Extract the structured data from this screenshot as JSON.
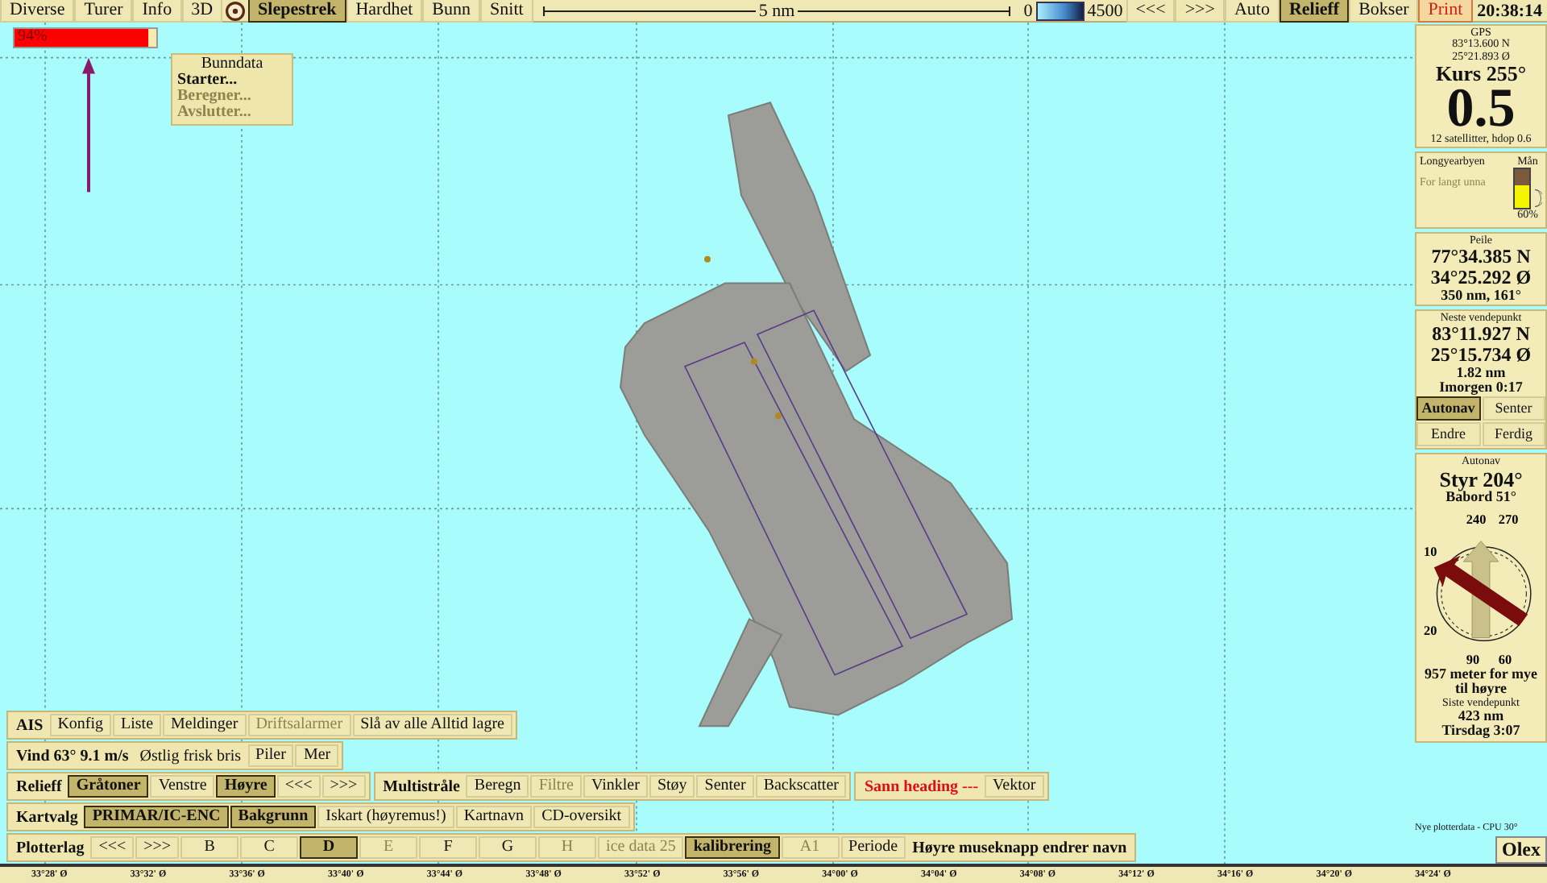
{
  "top_bar": {
    "items": [
      {
        "label": "Diverse",
        "kind": "button",
        "selected": false
      },
      {
        "label": "Turer",
        "kind": "button",
        "selected": false
      },
      {
        "label": "Info",
        "kind": "button",
        "selected": false
      },
      {
        "label": "3D",
        "kind": "button",
        "selected": false
      },
      {
        "kind": "target"
      },
      {
        "label": "Slepestrek",
        "kind": "button",
        "selected": true
      },
      {
        "label": "Hardhet",
        "kind": "button",
        "selected": false
      },
      {
        "label": "Bunn",
        "kind": "button",
        "selected": false
      },
      {
        "label": "Snitt",
        "kind": "button",
        "selected": false
      },
      {
        "label": "5 nm",
        "kind": "scale"
      },
      {
        "label": "0",
        "kind": "text"
      },
      {
        "kind": "gradient"
      },
      {
        "label": "4500",
        "kind": "text"
      },
      {
        "label": "<<<",
        "kind": "button",
        "selected": false
      },
      {
        "label": ">>>",
        "kind": "button",
        "selected": false
      },
      {
        "label": "Auto",
        "kind": "button",
        "selected": false
      },
      {
        "label": "Relieff",
        "kind": "button",
        "selected": true
      },
      {
        "label": "Bokser",
        "kind": "button",
        "selected": false
      },
      {
        "label": "Print",
        "kind": "alert"
      },
      {
        "label": "20:38:14",
        "kind": "clock"
      }
    ]
  },
  "progress": {
    "label": "94%",
    "level": 0.94
  },
  "menu": {
    "title": "Bunndata",
    "items": [
      {
        "label": "Starter...",
        "disabled": false
      },
      {
        "label": "Beregner...",
        "disabled": true
      },
      {
        "label": "Avslutter...",
        "disabled": true
      }
    ]
  },
  "toolbars": [
    [
      [
        {
          "label": "AIS",
          "kind": "label"
        },
        {
          "label": "Konfig",
          "kind": "button",
          "selected": false,
          "disabled": false
        },
        {
          "label": "Liste",
          "kind": "button",
          "selected": false,
          "disabled": false
        },
        {
          "label": "Meldinger",
          "kind": "button",
          "selected": false,
          "disabled": false
        },
        {
          "label": "Driftsalarmer",
          "kind": "button",
          "selected": false,
          "disabled": true
        },
        {
          "label": "Slå av alle Alltid lagre",
          "kind": "button",
          "selected": false,
          "disabled": false
        }
      ]
    ],
    [
      [
        {
          "label": "Vind 63° 9.1 m/s",
          "kind": "label"
        },
        {
          "label": "Østlig frisk bris",
          "kind": "text"
        },
        {
          "label": "Piler",
          "kind": "button",
          "selected": false,
          "disabled": false
        },
        {
          "label": "Mer",
          "kind": "button",
          "selected": false,
          "disabled": false
        }
      ]
    ],
    [
      [
        {
          "label": "Relieff",
          "kind": "label"
        },
        {
          "label": "Gråtoner",
          "kind": "button",
          "selected": true,
          "disabled": false
        },
        {
          "label": "Venstre",
          "kind": "button",
          "selected": false,
          "disabled": false
        },
        {
          "label": "Høyre",
          "kind": "button",
          "selected": true,
          "disabled": false
        },
        {
          "label": "<<<",
          "kind": "button",
          "selected": false,
          "disabled": false
        },
        {
          "label": ">>>",
          "kind": "button",
          "selected": false,
          "disabled": false
        }
      ],
      [
        {
          "label": "Multistråle",
          "kind": "label"
        },
        {
          "label": "Beregn",
          "kind": "button",
          "selected": false,
          "disabled": false
        },
        {
          "label": "Filtre",
          "kind": "button",
          "selected": false,
          "disabled": true
        },
        {
          "label": "Vinkler",
          "kind": "button",
          "selected": false,
          "disabled": false
        },
        {
          "label": "Støy",
          "kind": "button",
          "selected": false,
          "disabled": false
        },
        {
          "label": "Senter",
          "kind": "button",
          "selected": false,
          "disabled": false
        },
        {
          "label": "Backscatter",
          "kind": "button",
          "selected": false,
          "disabled": false
        }
      ],
      [
        {
          "label": "Sann heading ---",
          "kind": "alert"
        },
        {
          "label": "Vektor",
          "kind": "button",
          "selected": false,
          "disabled": false
        }
      ]
    ],
    [
      [
        {
          "label": "Kartvalg",
          "kind": "label"
        },
        {
          "label": "PRIMAR/IC-ENC",
          "kind": "button",
          "selected": true,
          "disabled": false
        },
        {
          "label": "Bakgrunn",
          "kind": "button",
          "selected": true,
          "disabled": false
        },
        {
          "label": "Iskart (høyremus!)",
          "kind": "button",
          "selected": false,
          "disabled": false
        },
        {
          "label": "Kartnavn",
          "kind": "button",
          "selected": false,
          "disabled": false
        },
        {
          "label": "CD-oversikt",
          "kind": "button",
          "selected": false,
          "disabled": false
        }
      ]
    ],
    [
      [
        {
          "label": "Plotterlag",
          "kind": "label"
        },
        {
          "label": "<<<",
          "kind": "button",
          "selected": false,
          "disabled": false
        },
        {
          "label": ">>>",
          "kind": "button",
          "selected": false,
          "disabled": false
        },
        {
          "label": "B",
          "kind": "wide",
          "selected": false,
          "disabled": false
        },
        {
          "label": "C",
          "kind": "wide",
          "selected": false,
          "disabled": false
        },
        {
          "label": "D",
          "kind": "wide",
          "selected": true,
          "disabled": false
        },
        {
          "label": "E",
          "kind": "wide",
          "selected": false,
          "disabled": true
        },
        {
          "label": "F",
          "kind": "wide",
          "selected": false,
          "disabled": false
        },
        {
          "label": "G",
          "kind": "wide",
          "selected": false,
          "disabled": false
        },
        {
          "label": "H",
          "kind": "wide",
          "selected": false,
          "disabled": true
        },
        {
          "label": "ice data 25",
          "kind": "button",
          "selected": false,
          "disabled": true
        },
        {
          "label": "kalibrering",
          "kind": "button",
          "selected": true,
          "disabled": false
        },
        {
          "label": "A1",
          "kind": "wide",
          "selected": false,
          "disabled": true
        },
        {
          "label": "Periode",
          "kind": "button",
          "selected": false,
          "disabled": false
        },
        {
          "label": "Høyre museknapp endrer navn",
          "kind": "label"
        }
      ]
    ]
  ],
  "x_axis": [
    "33°28' Ø",
    "33°32' Ø",
    "33°36' Ø",
    "33°40' Ø",
    "33°44' Ø",
    "33°48' Ø",
    "33°52' Ø",
    "33°56' Ø",
    "34°00' Ø",
    "34°04' Ø",
    "34°08' Ø",
    "34°12' Ø",
    "34°16' Ø",
    "34°20' Ø",
    "34°24' Ø"
  ],
  "gps": {
    "title": "GPS",
    "lat": "83°13.600 N",
    "lon": "25°21.893 Ø",
    "course": "Kurs 255°",
    "speed": "0.5",
    "status": "12 satellitter, hdop 0.6"
  },
  "tide": {
    "place": "Longyearbyen",
    "place_status": "For langt unna",
    "moon": {
      "label": "Mån",
      "level": 0.6,
      "percent": "60%"
    }
  },
  "bearing": {
    "title": "Peile",
    "lat": "77°34.385 N",
    "lon": "34°25.292 Ø",
    "info": "350 nm, 161°"
  },
  "waypoint": {
    "title": "Neste vendepunkt",
    "lat": "83°11.927 N",
    "lon": "25°15.734 Ø",
    "distance": "1.82 nm",
    "eta": "Imorgen 0:17",
    "buttons": [
      {
        "label": "Autonav",
        "selected": true
      },
      {
        "label": "Senter",
        "selected": false
      },
      {
        "label": "Endre",
        "selected": false
      },
      {
        "label": "Ferdig",
        "selected": false
      }
    ]
  },
  "autonav": {
    "title": "Autonav",
    "steer": "Styr 204°",
    "port": "Babord 51°",
    "compass_labels": [
      "240",
      "270",
      "10",
      "20",
      "90",
      "60"
    ],
    "message": "957 meter for mye til høyre",
    "last_title": "Siste vendepunkt",
    "last_distance": "423 nm",
    "last_time": "Tirsdag 3:07"
  },
  "status": "Nye plotterdata - CPU 30°",
  "logo": "Olex"
}
